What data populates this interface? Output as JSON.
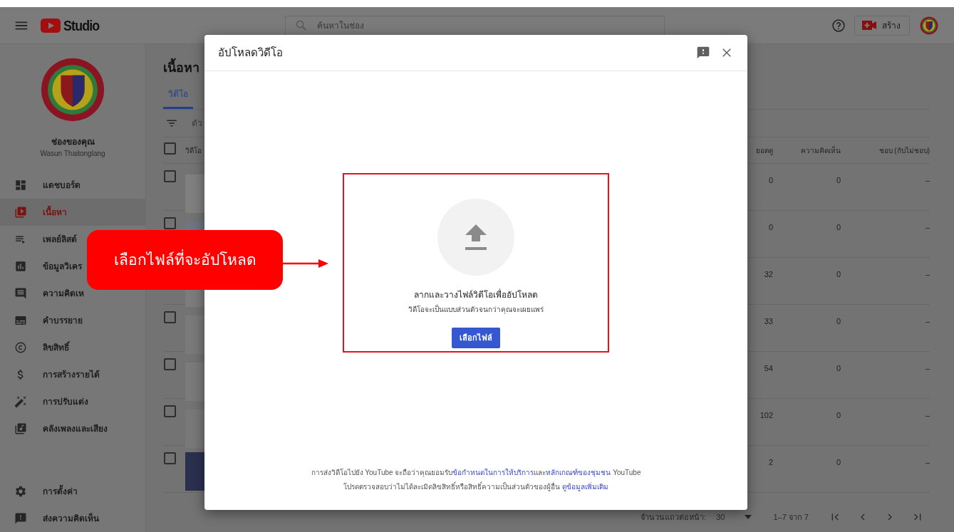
{
  "header": {
    "logo_text": "Studio",
    "search": {
      "placeholder": "ค้นหาในช่อง"
    },
    "create_label": "สร้าง"
  },
  "sidebar": {
    "channel_title": "ช่องของคุณ",
    "channel_name": "Wasun Thaitonglang",
    "items": [
      {
        "label": "แดชบอร์ด",
        "selected": false
      },
      {
        "label": "เนื้อหา",
        "selected": true
      },
      {
        "label": "เพลย์ลิสต์",
        "selected": false
      },
      {
        "label": "ข้อมูลวิเคร",
        "selected": false
      },
      {
        "label": "ความคิดเห",
        "selected": false
      },
      {
        "label": "คำบรรยาย",
        "selected": false
      },
      {
        "label": "ลิขสิทธิ์",
        "selected": false
      },
      {
        "label": "การสร้างรายได้",
        "selected": false
      },
      {
        "label": "การปรับแต่ง",
        "selected": false
      },
      {
        "label": "คลังเพลงและเสียง",
        "selected": false
      }
    ],
    "footer_items": [
      {
        "label": "การตั้งค่า"
      },
      {
        "label": "ส่งความคิดเห็น"
      }
    ]
  },
  "content": {
    "title": "เนื้อหา",
    "tabs": [
      {
        "label": "วิดีโอ",
        "selected": true
      }
    ],
    "filter_placeholder": "ตัว",
    "columns": [
      "วิดีโอ",
      "ยอดดู",
      "ความคิดเห็น",
      "ชอบ (กับไม่ชอบ)"
    ],
    "select_all_checked": false,
    "rows": [
      {
        "checked": false,
        "views": "0",
        "comments": "0",
        "likes": "–"
      },
      {
        "checked": false,
        "views": "0",
        "comments": "0",
        "likes": "–"
      },
      {
        "views": "32",
        "comments": "0",
        "likes": "–"
      },
      {
        "checked": false,
        "views": "33",
        "comments": "0",
        "likes": "–"
      },
      {
        "checked": false,
        "views": "54",
        "comments": "0",
        "likes": "–"
      },
      {
        "checked": false,
        "views": "102",
        "comments": "0",
        "likes": "–"
      },
      {
        "checked": false,
        "views": "2",
        "comments": "0",
        "likes": "–"
      }
    ],
    "pagination": {
      "rows_label": "จำนวนแถวต่อหน้า:",
      "rows_value": "30",
      "range": "1–7 จาก 7"
    }
  },
  "dialog": {
    "title": "อัปโหลดวิดีโอ",
    "prompt": "ลากและวางไฟล์วิดีโอเพื่ออัปโหลด",
    "note": "วิดีโอจะเป็นแบบส่วนตัวจนกว่าคุณจะเผยแพร่",
    "button": "เลือกไฟล์",
    "footer_lines": [
      [
        {
          "kind": "text",
          "text": "การส่งวิดีโอไปยัง YouTube จะถือว่าคุณยอมรับ"
        },
        {
          "kind": "link",
          "text": "ข้อกำหนดในการให้บริการ"
        },
        {
          "kind": "text",
          "text": "และ"
        },
        {
          "kind": "link",
          "text": "หลักเกณฑ์ของชุมชน"
        },
        {
          "kind": "text",
          "text": " YouTube"
        }
      ],
      [
        {
          "kind": "text",
          "text": "โปรดตรวจสอบว่าไม่ได้ละเมิดลิขสิทธิ์หรือสิทธิ์ความเป็นส่วนตัวของผู้อื่น "
        },
        {
          "kind": "link",
          "text": "ดูข้อมูลเพิ่มเติม"
        }
      ]
    ]
  },
  "callout": {
    "text": "เลือกไฟล์ที่จะอัปโหลด"
  }
}
